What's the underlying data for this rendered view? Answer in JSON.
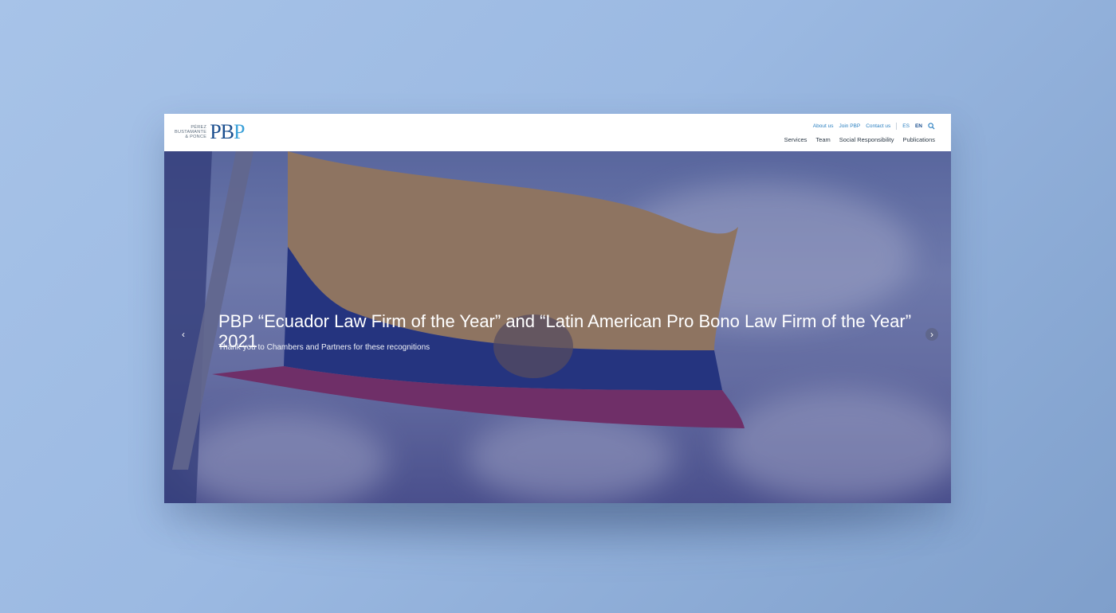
{
  "logo": {
    "words": [
      "PÉREZ",
      "BUSTAMANTE",
      "& PONCE"
    ],
    "mark_p1": "P",
    "mark_b": "B",
    "mark_p2": "P"
  },
  "top_nav": {
    "about": "About us",
    "join": "Join PBP",
    "contact": "Contact us",
    "lang_es": "ES",
    "lang_en": "EN"
  },
  "main_nav": {
    "services": "Services",
    "team": "Team",
    "social": "Social Responsibility",
    "publications": "Publications"
  },
  "hero": {
    "title": "PBP “Ecuador Law Firm of the Year” and “Latin American Pro Bono Law Firm of the Year” 2021",
    "subtitle": "Thank you to Chambers and Partners for these recognitions",
    "prev_arrow": "‹",
    "next_arrow": "›"
  },
  "colors": {
    "brand_dark": "#1b4f8f",
    "brand_light": "#3aa0d8",
    "link": "#2a7fc0"
  },
  "icons": [
    "search-icon",
    "chevron-left-icon",
    "chevron-right-icon"
  ]
}
